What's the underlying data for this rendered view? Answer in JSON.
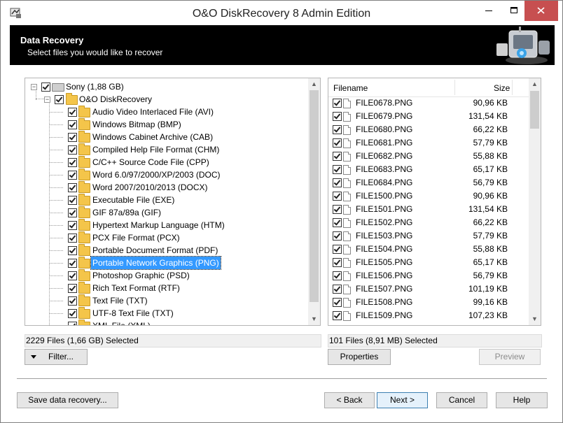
{
  "window": {
    "title": "O&O DiskRecovery 8 Admin Edition",
    "controls": {
      "minimize": "–",
      "maximize": "□",
      "close": "✕"
    }
  },
  "header": {
    "title": "Data Recovery",
    "subtitle": "Select files you would like to recover"
  },
  "tree": {
    "root": {
      "label": "Sony (1,88 GB)",
      "checked": true,
      "icon": "drive-icon"
    },
    "node": {
      "label": "O&O DiskRecovery",
      "checked": true,
      "icon": "folder-icon"
    },
    "items": [
      {
        "label": "Audio Video Interlaced File (AVI)",
        "checked": true
      },
      {
        "label": "Windows Bitmap (BMP)",
        "checked": true
      },
      {
        "label": "Windows Cabinet Archive (CAB)",
        "checked": true
      },
      {
        "label": "Compiled Help File Format (CHM)",
        "checked": true
      },
      {
        "label": "C/C++ Source Code File (CPP)",
        "checked": true
      },
      {
        "label": "Word 6.0/97/2000/XP/2003 (DOC)",
        "checked": true
      },
      {
        "label": "Word 2007/2010/2013 (DOCX)",
        "checked": true
      },
      {
        "label": "Executable File (EXE)",
        "checked": true
      },
      {
        "label": "GIF 87a/89a (GIF)",
        "checked": true
      },
      {
        "label": "Hypertext Markup Language (HTM)",
        "checked": true
      },
      {
        "label": "PCX File Format (PCX)",
        "checked": true
      },
      {
        "label": "Portable Document Format (PDF)",
        "checked": true
      },
      {
        "label": "Portable Network Graphics (PNG)",
        "checked": true,
        "selected": true
      },
      {
        "label": "Photoshop Graphic (PSD)",
        "checked": true
      },
      {
        "label": "Rich Text Format (RTF)",
        "checked": true
      },
      {
        "label": "Text File (TXT)",
        "checked": true
      },
      {
        "label": "UTF-8 Text File (TXT)",
        "checked": true
      },
      {
        "label": "XML File (XML)",
        "checked": true
      }
    ]
  },
  "file_list": {
    "columns": {
      "filename": "Filename",
      "size": "Size"
    },
    "rows": [
      {
        "name": "FILE0678.PNG",
        "size": "90,96 KB"
      },
      {
        "name": "FILE0679.PNG",
        "size": "131,54 KB"
      },
      {
        "name": "FILE0680.PNG",
        "size": "66,22 KB"
      },
      {
        "name": "FILE0681.PNG",
        "size": "57,79 KB"
      },
      {
        "name": "FILE0682.PNG",
        "size": "55,88 KB"
      },
      {
        "name": "FILE0683.PNG",
        "size": "65,17 KB"
      },
      {
        "name": "FILE0684.PNG",
        "size": "56,79 KB"
      },
      {
        "name": "FILE1500.PNG",
        "size": "90,96 KB"
      },
      {
        "name": "FILE1501.PNG",
        "size": "131,54 KB"
      },
      {
        "name": "FILE1502.PNG",
        "size": "66,22 KB"
      },
      {
        "name": "FILE1503.PNG",
        "size": "57,79 KB"
      },
      {
        "name": "FILE1504.PNG",
        "size": "55,88 KB"
      },
      {
        "name": "FILE1505.PNG",
        "size": "65,17 KB"
      },
      {
        "name": "FILE1506.PNG",
        "size": "56,79 KB"
      },
      {
        "name": "FILE1507.PNG",
        "size": "101,19 KB"
      },
      {
        "name": "FILE1508.PNG",
        "size": "99,16 KB"
      },
      {
        "name": "FILE1509.PNG",
        "size": "107,23 KB"
      }
    ]
  },
  "status": {
    "left": "2229 Files (1,66 GB) Selected",
    "right": "101 Files (8,91 MB) Selected"
  },
  "buttons": {
    "filter": "Filter...",
    "properties": "Properties",
    "preview": "Preview",
    "save": "Save data recovery...",
    "back": "< Back",
    "next": "Next >",
    "cancel": "Cancel",
    "help": "Help"
  }
}
